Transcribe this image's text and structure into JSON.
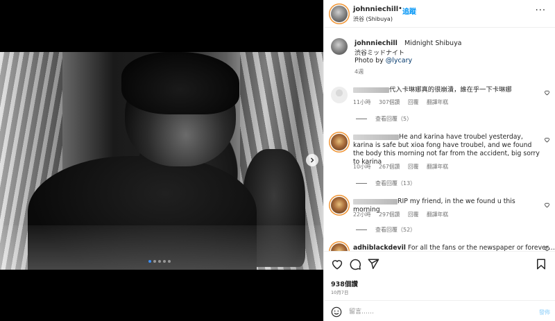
{
  "header": {
    "username": "johnniechill",
    "separator": "•",
    "follow_label": "追蹤",
    "location": "渋谷 (Shibuya)",
    "more_label": "···"
  },
  "caption": {
    "username": "johnniechill",
    "title": "Midnight Shibuya",
    "japanese": "渋谷ミッドナイト",
    "photo_by_prefix": "Photo by ",
    "photo_by_mention": "@lycary",
    "time": "4週"
  },
  "comments": [
    {
      "text": "代入卡琳娜真的很崩潰，誰在乎一下卡琳娜",
      "time": "11小時",
      "likes": "307個讚",
      "reply": "回覆",
      "translate": "翻譯年糕",
      "view_replies": "查看回覆（5）"
    },
    {
      "text": "He and karina have troubel yesterday, karina is safe but xioa fong have troubel, and we found the body this morning not far from the accident, big sorry to karina",
      "time": "10小時",
      "likes": "267個讚",
      "reply": "回覆",
      "translate": "翻譯年糕",
      "view_replies": "查看回覆（13）"
    },
    {
      "text": "RIP my friend, in the we found u this morning",
      "time": "22小時",
      "likes": "297個讚",
      "reply": "回覆",
      "translate": "翻譯年糕",
      "view_replies": "查看回覆（52）"
    },
    {
      "username": "adhiblackdevil",
      "text": "For all the fans or the newspaper or forever…!"
    }
  ],
  "footer": {
    "likes": "938個讚",
    "date": "10月7日",
    "comment_placeholder": "留言……",
    "post_label": "發佈"
  },
  "media": {
    "slide_count": 5,
    "active_slide": 1
  },
  "colors": {
    "link_blue": "#0095f6",
    "mention_blue": "#00376b",
    "muted": "#737373"
  }
}
